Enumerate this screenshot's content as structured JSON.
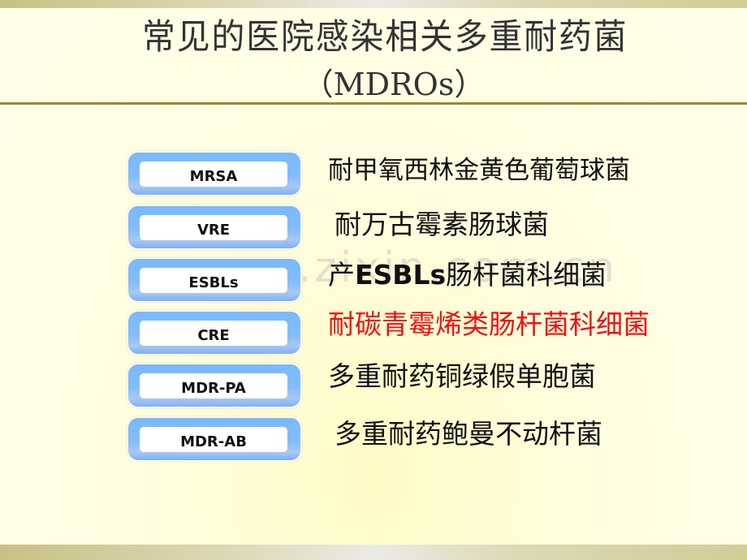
{
  "slide": {
    "title": "常见的医院感染相关多重耐药菌",
    "subtitle": "（MDROs）",
    "watermark": "www.zixin.com.cn",
    "accent_color": "#ee1111",
    "items": [
      {
        "abbr": "MRSA",
        "desc_pre": "耐甲氧西林金黄色葡萄球菌",
        "desc_bold": "",
        "desc_post": "",
        "highlight": false
      },
      {
        "abbr": "VRE",
        "desc_pre": "耐万古霉素肠球菌",
        "desc_bold": "",
        "desc_post": "",
        "highlight": false
      },
      {
        "abbr": "ESBLs",
        "desc_pre": "产",
        "desc_bold": "ESBLs",
        "desc_post": "肠杆菌科细菌",
        "highlight": false
      },
      {
        "abbr": "CRE",
        "desc_pre": "耐碳青霉烯类肠杆菌科细菌",
        "desc_bold": "",
        "desc_post": "",
        "highlight": true
      },
      {
        "abbr": "MDR-PA",
        "desc_pre": "多重耐药铜绿假单胞菌",
        "desc_bold": "",
        "desc_post": "",
        "highlight": false
      },
      {
        "abbr": "MDR-AB",
        "desc_pre": "多重耐药鲍曼不动杆菌",
        "desc_bold": "",
        "desc_post": "",
        "highlight": false
      }
    ]
  }
}
